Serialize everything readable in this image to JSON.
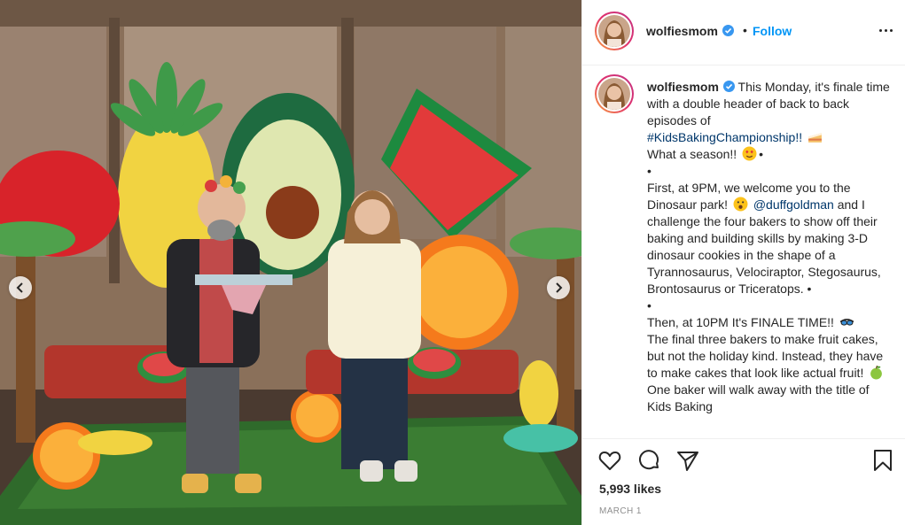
{
  "post": {
    "username": "wolfiesmom",
    "follow_separator": "•",
    "follow_label": "Follow",
    "caption": {
      "username": "wolfiesmom",
      "line1_text": "This Monday, it's finale time with a double header of back to back episodes of",
      "hashtag": "#KidsBakingChampionship!!",
      "line2_text": "What a season!!",
      "bullet": "•",
      "para2_start": "First, at 9PM, we welcome you to the Dinosaur park!",
      "mention": "@duffgoldman",
      "para2_end": "and I challenge the four bakers to show off their baking and building skills by making 3-D dinosaur cookies in the shape of a Tyrannosaurus, Velociraptor, Stegosaurus, Brontosaurus or Triceratops. •",
      "para3_start": "Then, at 10PM It's FINALE TIME!!",
      "para3_mid": "The final three bakers to make fruit cakes, but not the holiday kind. Instead, they have to make cakes that look like actual fruit!",
      "para3_end": "One baker will walk away with the title of Kids Baking"
    },
    "likes": "5,993 likes",
    "date": "MARCH 1"
  },
  "icons": {
    "verified": "verified-badge-icon",
    "more": "more-options-icon",
    "like": "heart-icon",
    "comment": "comment-bubble-icon",
    "share": "paper-plane-icon",
    "save": "bookmark-icon",
    "prev": "chevron-left-icon",
    "next": "chevron-right-icon"
  },
  "colors": {
    "follow": "#0095f6",
    "link": "#00376b",
    "verified": "#3897f0",
    "muted": "#8e8e8e"
  }
}
